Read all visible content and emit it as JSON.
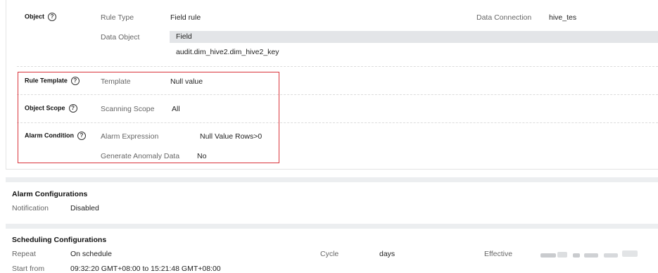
{
  "object": {
    "section_label": "Object",
    "rule_type_label": "Rule Type",
    "rule_type_value": "Field rule",
    "data_connection_label": "Data Connection",
    "data_connection_value": "hive_tes",
    "data_object_label": "Data Object",
    "field_header": "Field",
    "field_value": "audit.dim_hive2.dim_hive2_key"
  },
  "rule_template": {
    "section_label": "Rule Template",
    "template_label": "Template",
    "template_value": "Null value"
  },
  "object_scope": {
    "section_label": "Object Scope",
    "scanning_scope_label": "Scanning Scope",
    "scanning_scope_value": "All"
  },
  "alarm_condition": {
    "section_label": "Alarm Condition",
    "expression_label": "Alarm Expression",
    "expression_value": "Null Value Rows>0",
    "anomaly_label": "Generate Anomaly Data",
    "anomaly_value": "No"
  },
  "help_glyph": "?",
  "alarm_config": {
    "title": "Alarm Configurations",
    "notification_label": "Notification",
    "notification_value": "Disabled"
  },
  "scheduling": {
    "title": "Scheduling Configurations",
    "repeat_label": "Repeat",
    "repeat_value": "On schedule",
    "cycle_label": "Cycle",
    "cycle_value": "days",
    "effective_label": "Effective",
    "start_label": "Start from",
    "start_value": "09:32:20 GMT+08:00 to 15:21:48 GMT+08:00"
  },
  "colors": {
    "highlight_border": "#d9333a",
    "field_header_bg": "#e3e5e8",
    "divider_band": "#eceef0"
  }
}
